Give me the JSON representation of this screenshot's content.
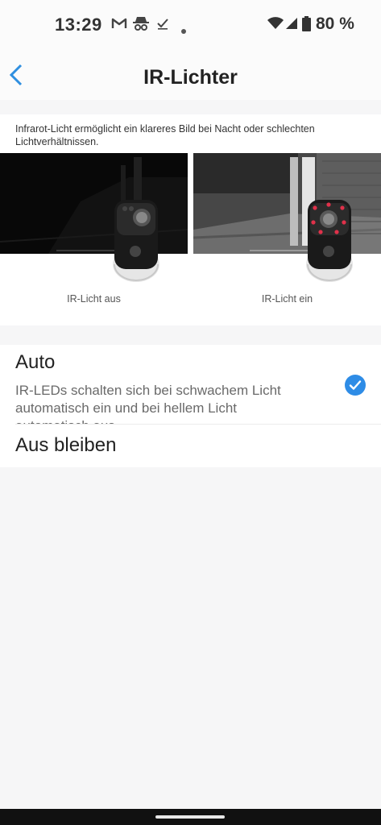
{
  "status_bar": {
    "time": "13:29",
    "battery": "80 %",
    "icons": [
      "gmail-icon",
      "incognito-icon",
      "check-mark-icon",
      "notification-dot-icon",
      "wifi-icon",
      "cell-signal-icon",
      "battery-icon"
    ]
  },
  "header": {
    "title": "IR-Lichter",
    "back_icon": "chevron-left-icon",
    "accent_color": "#2f8fe0"
  },
  "info": {
    "description": "Infrarot-Licht ermöglicht ein klareres Bild bei Nacht oder schlechten Lichtverhältnissen.",
    "preview_off_label": "IR-Licht aus",
    "preview_on_label": "IR-Licht ein"
  },
  "options": [
    {
      "title": "Auto",
      "description": "IR-LEDs schalten sich bei schwachem Licht automatisch ein und bei hellem Licht automatisch aus.",
      "selected": true
    },
    {
      "title": "Aus bleiben",
      "selected": false
    }
  ],
  "colors": {
    "check": "#2e8ce6",
    "ir_led": "#e0314a"
  }
}
